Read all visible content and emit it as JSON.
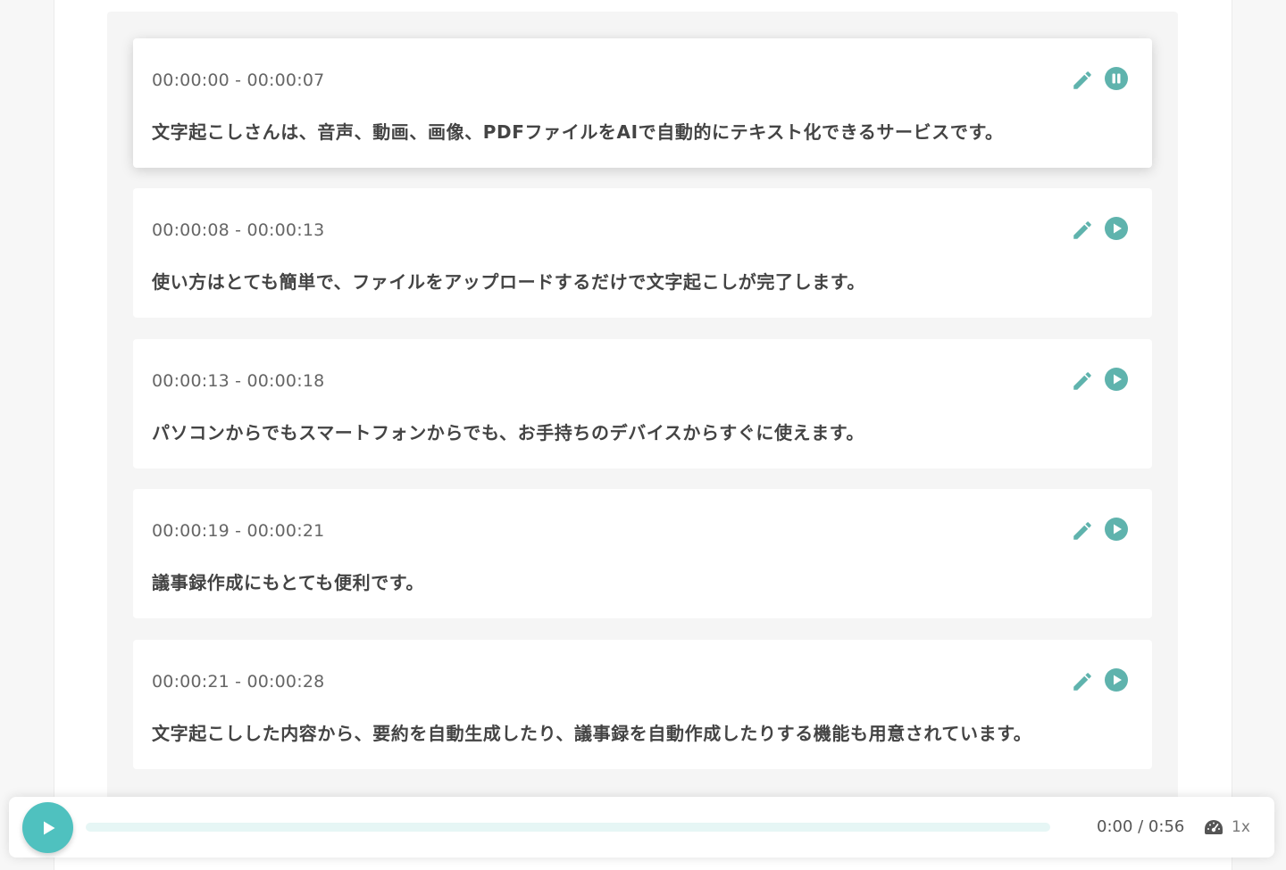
{
  "colors": {
    "accent": "#4fc1bf",
    "icon": "#5fb3ad",
    "text": "#444444",
    "timestamp": "#666666"
  },
  "segments": [
    {
      "time": "00:00:00 - 00:00:07",
      "text": "文字起こしさんは、音声、動画、画像、PDFファイルをAIで自動的にテキスト化できるサービスです。",
      "state": "playing",
      "icons": [
        "pencil-icon",
        "pause-icon"
      ]
    },
    {
      "time": "00:00:08 - 00:00:13",
      "text": "使い方はとても簡単で、ファイルをアップロードするだけで文字起こしが完了します。",
      "state": "idle",
      "icons": [
        "pencil-icon",
        "play-icon"
      ]
    },
    {
      "time": "00:00:13 - 00:00:18",
      "text": "パソコンからでもスマートフォンからでも、お手持ちのデバイスからすぐに使えます。",
      "state": "idle",
      "icons": [
        "pencil-icon",
        "play-icon"
      ]
    },
    {
      "time": "00:00:19 - 00:00:21",
      "text": "議事録作成にもとても便利です。",
      "state": "idle",
      "icons": [
        "pencil-icon",
        "play-icon"
      ]
    },
    {
      "time": "00:00:21 - 00:00:28",
      "text": "文字起こしした内容から、要約を自動生成したり、議事録を自動作成したりする機能も用意されています。",
      "state": "idle",
      "icons": [
        "pencil-icon",
        "play-icon"
      ]
    }
  ],
  "player": {
    "time": "0:00 / 0:56",
    "progress": 0,
    "speed": "1x",
    "icons": [
      "play-icon",
      "speedometer-icon"
    ]
  }
}
